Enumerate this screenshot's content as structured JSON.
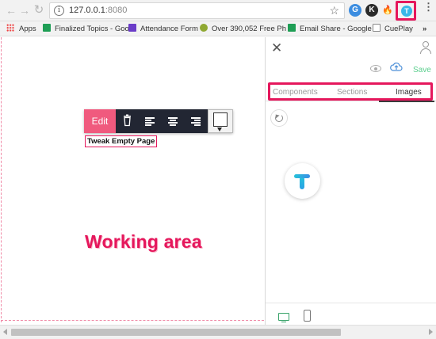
{
  "browser": {
    "url_host": "127.0.0.1",
    "url_port": ":8080",
    "info_glyph": "i",
    "star_glyph": "☆",
    "extensions": [
      {
        "name": "G",
        "color": "#3c8de0"
      },
      {
        "name": "K",
        "color": "#2b2b2b"
      },
      {
        "name": "🔥",
        "color": "#f2f2f2"
      },
      {
        "name": "T",
        "color": "#3ab7e8"
      }
    ],
    "menu": "⋮"
  },
  "bookmarks": {
    "items": [
      {
        "label": "Apps",
        "icon_color": "#e44"
      },
      {
        "label": "Finalized Topics - Goo",
        "icon_color": "#1e9e55"
      },
      {
        "label": "Attendance Form",
        "icon_color": "#6a3cc8"
      },
      {
        "label": "Over 390,052 Free Ph",
        "icon_color": "#8fa832"
      },
      {
        "label": "Email Share - Google",
        "icon_color": "#1e9e55"
      },
      {
        "label": "CuePlay",
        "icon_color": "#888888"
      }
    ],
    "overflow": "»"
  },
  "toolbar": {
    "edit_label": "Edit"
  },
  "canvas": {
    "tweak_label": "Tweak Empty Page",
    "annotation": "Working area"
  },
  "panel": {
    "save_label": "Save",
    "close_glyph": "✕",
    "tabs": [
      {
        "label": "Components",
        "active": false
      },
      {
        "label": "Sections",
        "active": false
      },
      {
        "label": "Images",
        "active": true
      }
    ]
  },
  "colors": {
    "accent_pink": "#e5175c",
    "edit_button": "#f05a7e",
    "save_green": "#5dcf8f",
    "toolbar_dark": "#222633"
  }
}
